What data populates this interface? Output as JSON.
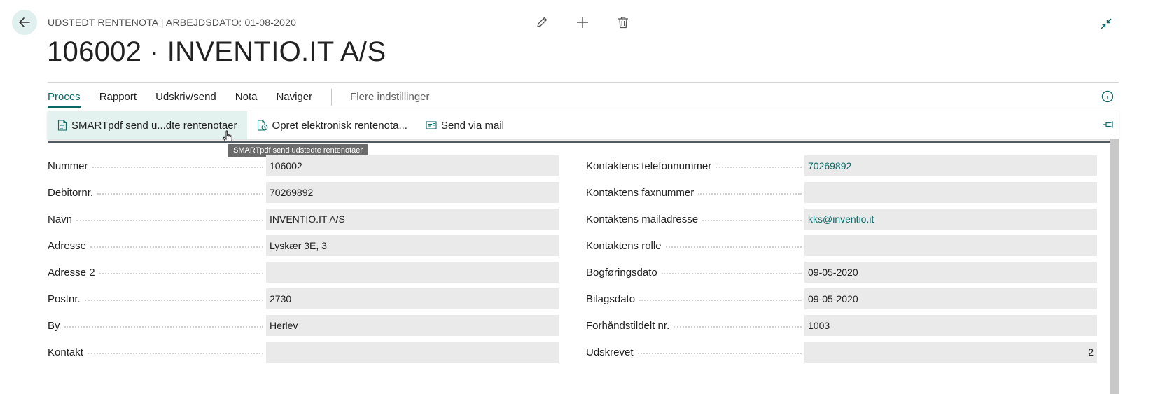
{
  "header": {
    "caption": "UDSTEDT RENTENOTA | ARBEJDSDATO: 01-08-2020",
    "title": "106002 · INVENTIO.IT A/S",
    "icons": [
      "back-arrow-icon",
      "edit-pencil-icon",
      "add-plus-icon",
      "delete-trash-icon",
      "collapse-icon"
    ]
  },
  "menu": {
    "items": [
      {
        "label": "Proces",
        "active": true
      },
      {
        "label": "Rapport"
      },
      {
        "label": "Udskriv/send"
      },
      {
        "label": "Nota"
      },
      {
        "label": "Naviger"
      }
    ],
    "more": "Flere indstillinger"
  },
  "actions": {
    "items": [
      {
        "label": "SMARTpdf send u...dte rentenotaer",
        "icon": "pdf-document-icon"
      },
      {
        "label": "Opret elektronisk rentenota...",
        "icon": "electronic-document-icon"
      },
      {
        "label": "Send via mail",
        "icon": "mail-icon"
      }
    ],
    "tooltip": "SMARTpdf send udstedte rentenotaer"
  },
  "fields": {
    "left": [
      {
        "label": "Nummer",
        "value": "106002"
      },
      {
        "label": "Debitornr.",
        "value": "70269892"
      },
      {
        "label": "Navn",
        "value": "INVENTIO.IT A/S"
      },
      {
        "label": "Adresse",
        "value": "Lyskær 3E, 3"
      },
      {
        "label": "Adresse 2",
        "value": ""
      },
      {
        "label": "Postnr.",
        "value": "2730"
      },
      {
        "label": "By",
        "value": "Herlev"
      },
      {
        "label": "Kontakt",
        "value": ""
      }
    ],
    "right": [
      {
        "label": "Kontaktens telefonnummer",
        "value": "70269892"
      },
      {
        "label": "Kontaktens faxnummer",
        "value": ""
      },
      {
        "label": "Kontaktens mailadresse",
        "value": "kks@inventio.it"
      },
      {
        "label": "Kontaktens rolle",
        "value": ""
      },
      {
        "label": "Bogføringsdato",
        "value": "09-05-2020"
      },
      {
        "label": "Bilagsdato",
        "value": "09-05-2020"
      },
      {
        "label": "Forhåndstildelt nr.",
        "value": "1003"
      },
      {
        "label": "Udskrevet",
        "value": "2"
      }
    ]
  },
  "colors": {
    "accent": "#0b6a67",
    "field_bg": "#eaeaea",
    "hover_bg": "#e3f1ef"
  }
}
